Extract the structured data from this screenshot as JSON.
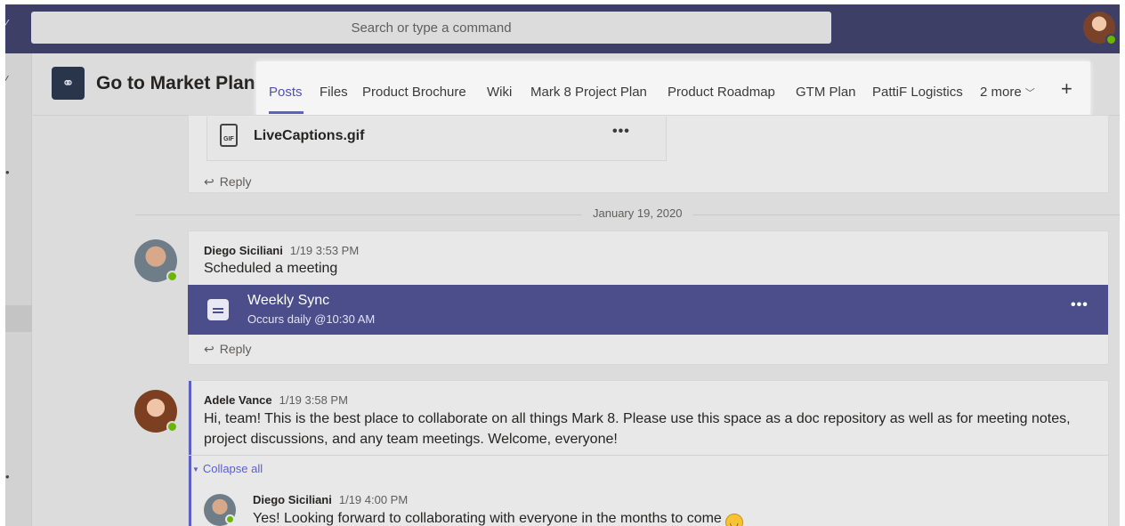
{
  "topbar": {
    "search_placeholder": "Search or type a command"
  },
  "team": {
    "name": "Go to Market Plan",
    "icon": "team-logo-icon"
  },
  "tabs": [
    {
      "label": "Posts",
      "active": true
    },
    {
      "label": "Files"
    },
    {
      "label": "Product Brochure"
    },
    {
      "label": "Wiki"
    },
    {
      "label": "Mark 8 Project Plan"
    },
    {
      "label": "Product Roadmap"
    },
    {
      "label": "GTM Plan"
    },
    {
      "label": "PattiF Logistics"
    }
  ],
  "more_tabs_label": "2 more",
  "feed": {
    "attachment": {
      "file_name": "LiveCaptions.gif",
      "file_type": "GIF"
    },
    "reply_label": "Reply",
    "date_divider": "January 19, 2020",
    "post1": {
      "author": "Diego Siciliani",
      "time": "1/19 3:53 PM",
      "text": "Scheduled a meeting",
      "meeting": {
        "title": "Weekly Sync",
        "subtitle": "Occurs daily @10:30 AM"
      }
    },
    "post2": {
      "author": "Adele Vance",
      "time": "1/19 3:58 PM",
      "text_line1": "Hi, team! This is the best place to collaborate on all things Mark 8. Please use this space as a doc repository as well as for meeting notes,",
      "text_line2": "project discussions, and any team meetings. Welcome, everyone!",
      "collapse_label": "Collapse all",
      "reply": {
        "author": "Diego Siciliani",
        "time": "1/19 4:00 PM",
        "text": "Yes! Looking forward to collaborating with everyone in the months to come"
      }
    }
  },
  "colors": {
    "topbar": "#3d3f67",
    "accent": "#5b5fc7",
    "meeting_bar": "#4b4e8a",
    "presence_available": "#6bb700"
  }
}
